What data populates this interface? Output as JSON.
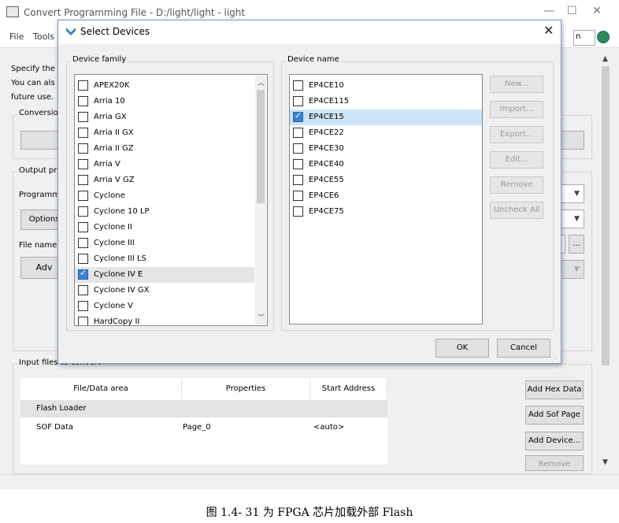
{
  "background_window": {
    "title": "Convert Programming File - D:/light/light - light",
    "menus": [
      "File",
      "Tools"
    ],
    "search_suffix": "n",
    "left_text": [
      "Specify the",
      "You can als",
      "future use.",
      "Conversio",
      "Output pr",
      "Programm",
      "Options",
      "File name",
      "Adv"
    ],
    "input_files_label": "Input files to convert",
    "table": {
      "headers": [
        "File/Data area",
        "Properties",
        "Start Address"
      ],
      "rows": [
        {
          "area": "Flash Loader",
          "props": "",
          "addr": ""
        },
        {
          "area": "SOF Data",
          "props": "Page_0",
          "addr": "<auto>"
        }
      ]
    },
    "side_buttons": [
      "Add Hex Data",
      "Add Sof Page",
      "Add Device...",
      "Remove"
    ],
    "browse_label": "..."
  },
  "dialog": {
    "title": "Select Devices",
    "close_glyph": "✕",
    "device_family": {
      "label": "Device family",
      "items": [
        {
          "name": "APEX20K",
          "checked": false,
          "selected": false
        },
        {
          "name": "Arria 10",
          "checked": false,
          "selected": false
        },
        {
          "name": "Arria GX",
          "checked": false,
          "selected": false
        },
        {
          "name": "Arria II GX",
          "checked": false,
          "selected": false
        },
        {
          "name": "Arria II GZ",
          "checked": false,
          "selected": false
        },
        {
          "name": "Arria V",
          "checked": false,
          "selected": false
        },
        {
          "name": "Arria V GZ",
          "checked": false,
          "selected": false
        },
        {
          "name": "Cyclone",
          "checked": false,
          "selected": false
        },
        {
          "name": "Cyclone 10 LP",
          "checked": false,
          "selected": false
        },
        {
          "name": "Cyclone II",
          "checked": false,
          "selected": false
        },
        {
          "name": "Cyclone III",
          "checked": false,
          "selected": false
        },
        {
          "name": "Cyclone III LS",
          "checked": false,
          "selected": false
        },
        {
          "name": "Cyclone IV E",
          "checked": true,
          "selected": true
        },
        {
          "name": "Cyclone IV GX",
          "checked": false,
          "selected": false
        },
        {
          "name": "Cyclone V",
          "checked": false,
          "selected": false
        },
        {
          "name": "HardCopy II",
          "checked": false,
          "selected": false
        }
      ]
    },
    "device_name": {
      "label": "Device name",
      "items": [
        {
          "name": "EP4CE10",
          "checked": false,
          "selected": false
        },
        {
          "name": "EP4CE115",
          "checked": false,
          "selected": false
        },
        {
          "name": "EP4CE15",
          "checked": true,
          "selected": true
        },
        {
          "name": "EP4CE22",
          "checked": false,
          "selected": false
        },
        {
          "name": "EP4CE30",
          "checked": false,
          "selected": false
        },
        {
          "name": "EP4CE40",
          "checked": false,
          "selected": false
        },
        {
          "name": "EP4CE55",
          "checked": false,
          "selected": false
        },
        {
          "name": "EP4CE6",
          "checked": false,
          "selected": false
        },
        {
          "name": "EP4CE75",
          "checked": false,
          "selected": false
        }
      ]
    },
    "buttons": {
      "new": "New...",
      "import": "Import...",
      "export": "Export...",
      "edit": "Edit...",
      "remove": "Remove",
      "uncheck_all": "Uncheck All",
      "ok": "OK",
      "cancel": "Cancel"
    }
  },
  "caption": "图 1.4- 31 为 FPGA 芯片加载外部 Flash",
  "colors": {
    "accent": "#3b82d6",
    "selected_row": "#cce4f7"
  },
  "icons": [
    "app-icon",
    "dialog-icon",
    "globe-icon",
    "close-icon",
    "chevron-down-icon",
    "scroll-up-icon",
    "scroll-down-icon"
  ]
}
